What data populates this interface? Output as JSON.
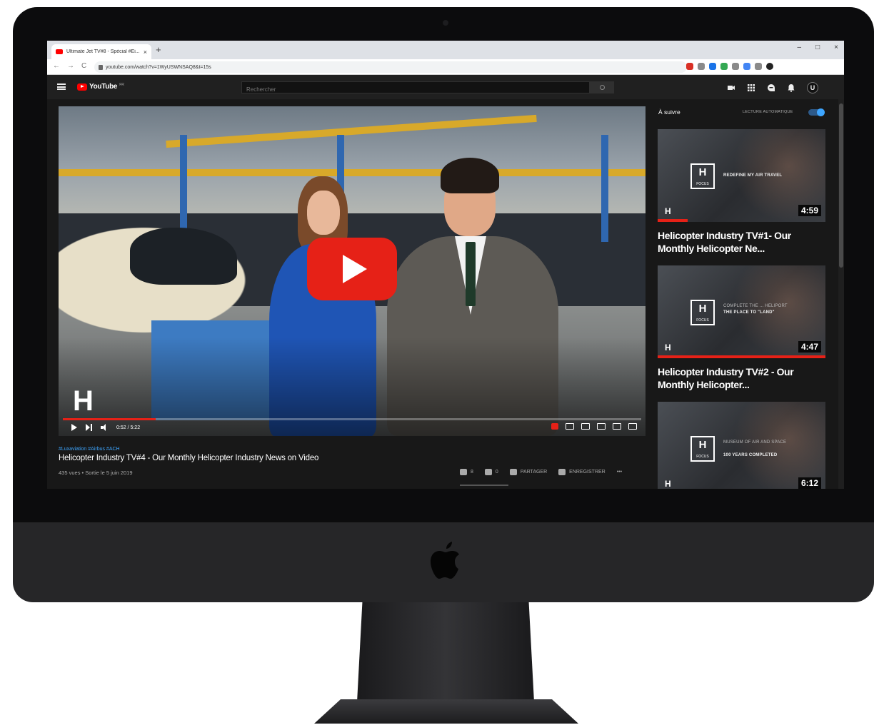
{
  "browser": {
    "tab_title": "Ultimate Jet TV#8 - Spécial #Ei...",
    "tab_close": "×",
    "new_tab": "+",
    "window_controls": [
      "–",
      "□",
      "×"
    ],
    "nav": [
      "←",
      "→",
      "C"
    ],
    "url": "youtube.com/watch?v=1WyUSWNSAQ8&t=15s",
    "extension_colors": [
      "#d93025",
      "#8a8a8a",
      "#1a73e8",
      "#34a853",
      "#8a8a8a",
      "#4285f4",
      "#8a8a8a",
      "#222222"
    ]
  },
  "youtube_header": {
    "logo_text": "YouTube",
    "logo_region": "FR",
    "search_placeholder": "Rechercher",
    "avatar_letter": "U"
  },
  "player": {
    "channel_logo": "H",
    "current_time": "0:52",
    "duration": "5:22",
    "time_display": "0:52 / 5:22",
    "progress_fraction": 0.161
  },
  "video_info": {
    "hashtags": "#Luxaviation #Airbus #ACH",
    "title": "Helicopter Industry TV#4 - Our Monthly Helicopter Industry News on Video",
    "meta": "435 vues • Sortie le 5 juin 2019",
    "likes": "8",
    "dislikes": "0",
    "share_label": "PARTAGER",
    "save_label": "ENREGISTRER",
    "more_label": "•••"
  },
  "sidebar": {
    "up_next": "À suivre",
    "autoplay_label": "LECTURE AUTOMATIQUE",
    "autoplay_on": true,
    "cards": [
      {
        "title": "Helicopter Industry TV#1- Our Monthly Helicopter Ne...",
        "duration": "4:59",
        "badge": "H",
        "badge_sub": "FOCUS",
        "caption_line1": "REDEFINE MY AIR TRAVEL",
        "caption_line2": "",
        "watched_fraction": 0.18
      },
      {
        "title": "Helicopter Industry TV#2 - Our Monthly Helicopter...",
        "duration": "4:47",
        "badge": "H",
        "badge_sub": "FOCUS",
        "caption_line1": "COMPLETE THE ... HELIPORT",
        "caption_line2": "THE PLACE TO \"LAND\"",
        "watched_fraction": 1.0
      },
      {
        "title": "",
        "duration": "6:12",
        "badge": "H",
        "badge_sub": "FOCUS",
        "caption_line1": "MUSEUM OF AIR AND SPACE",
        "caption_line2": "100 YEARS COMPLETED",
        "watched_fraction": 0
      }
    ]
  },
  "colors": {
    "yt_red": "#e62117",
    "yt_dark": "#181818",
    "link_blue": "#3ea6ff"
  }
}
